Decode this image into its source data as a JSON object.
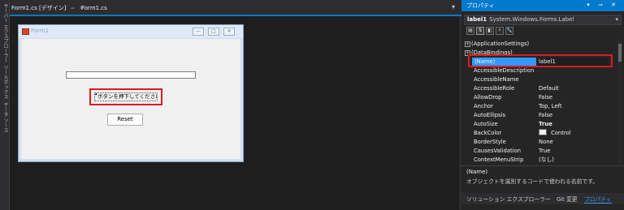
{
  "side_strip": {
    "tabs": [
      "サーバー エクスプローラー",
      "ツールボックス",
      "データ ソース"
    ]
  },
  "doc_tabs": {
    "designer_tab": "Form1.cs [デザイン]",
    "code_tab": "Form1.cs",
    "pin_icon": "pin-icon",
    "close_glyph": "✕",
    "pin_glyph": "⊸",
    "menu_glyph": "▾"
  },
  "form": {
    "title": "Form1",
    "window_buttons": [
      "—",
      "□",
      "✕"
    ],
    "label_text": "ボタンを押下してください",
    "reset_button": "Reset"
  },
  "properties": {
    "panel_title": "プロパティ",
    "title_controls": "▾ ⊸ ✕",
    "object_name": "label1",
    "object_type": "System.Windows.Forms.Label",
    "dropdown_glyph": "▾",
    "toolbar": [
      "▤",
      "⇅",
      "◧",
      "⚡",
      "🔧"
    ],
    "categories": [
      {
        "expand": "+",
        "label": "(ApplicationSettings)"
      },
      {
        "expand": "+",
        "label": "(DataBindings)"
      }
    ],
    "name_row": {
      "name": "(Name)",
      "value": "label1"
    },
    "rows": [
      {
        "name": "AccessibleDescription",
        "value": ""
      },
      {
        "name": "AccessibleName",
        "value": ""
      },
      {
        "name": "AccessibleRole",
        "value": "Default"
      },
      {
        "name": "AllowDrop",
        "value": "False"
      },
      {
        "name": "Anchor",
        "value": "Top, Left"
      },
      {
        "name": "AutoEllipsis",
        "value": "False"
      },
      {
        "name": "AutoSize",
        "value": "True"
      },
      {
        "name": "BackColor",
        "value": "Control"
      },
      {
        "name": "BorderStyle",
        "value": "None"
      },
      {
        "name": "CausesValidation",
        "value": "True"
      },
      {
        "name": "ContextMenuStrip",
        "value": "(なし)"
      }
    ],
    "desc_title": "(Name)",
    "desc_text": "オブジェクトを識別するコードで使われる名前です。",
    "bottom_tabs": [
      "ソリューション エクスプローラー",
      "Git 変更",
      "プロパティ"
    ],
    "backcolor_swatch": "#f0f0f0"
  }
}
